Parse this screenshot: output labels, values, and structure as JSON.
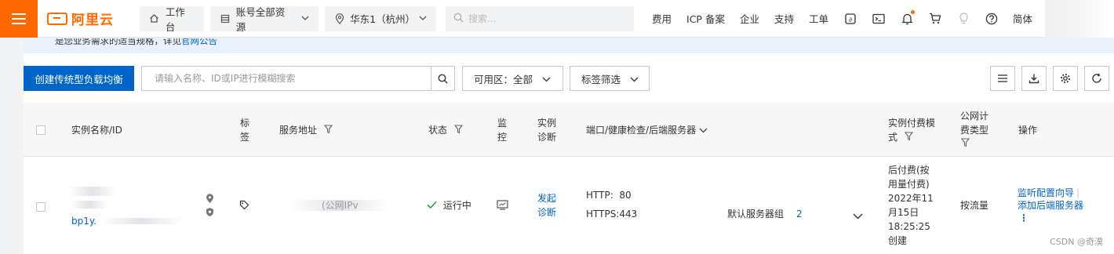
{
  "brand": {
    "name": "阿里云",
    "color": "#ff6a00"
  },
  "topbar": {
    "workbench": "工作台",
    "resources": "账号全部资源",
    "region": "华东1（杭州）",
    "search_placeholder": "搜索...",
    "links": [
      "费用",
      "ICP 备案",
      "企业",
      "支持",
      "工单"
    ],
    "icons": [
      "cloud-shell-icon",
      "terminal-icon",
      "bell-icon",
      "cart-icon",
      "bulb-icon",
      "help-icon"
    ],
    "lang": "简体"
  },
  "notice": {
    "text": "是您业务需求的适当规格，详见",
    "link": "官网公告"
  },
  "toolbar": {
    "create_label": "创建传统型负载均衡",
    "search_placeholder": "请输入名称、ID或IP进行模糊搜索",
    "zone_label": "可用区：",
    "zone_value": "全部",
    "tag_filter": "标签筛选"
  },
  "table": {
    "headers": {
      "name": "实例名称/ID",
      "tag_1": "标",
      "tag_2": "签",
      "address": "服务地址",
      "status": "状态",
      "monitor_1": "监",
      "monitor_2": "控",
      "diag_1": "实例",
      "diag_2": "诊断",
      "ports": "端口/健康检查/后端服务器",
      "billing_1": "实例付费模",
      "billing_2": "式",
      "net_1": "公网计",
      "net_2": "费类型",
      "actions": "操作"
    },
    "row": {
      "id_prefix": "bp1y.",
      "address_suffix": "(公网IPv",
      "status": "运行中",
      "diag_1": "发起",
      "diag_2": "诊断",
      "http": "HTTP:  80",
      "https": "HTTPS:443",
      "server_group": "默认服务器组",
      "server_count": "2",
      "billing": [
        "后付费(按",
        "用量付费)",
        "2022年11",
        "月15日",
        "18:25:25",
        "创建"
      ],
      "net_billing": "按流量",
      "action_1": "监听配置向导",
      "action_2": "添加后端服务器",
      "more": "⋮"
    }
  },
  "watermark": "CSDN @奇漠",
  "colors": {
    "primary": "#0064c8",
    "success": "#1aa33b",
    "notice_bg": "#e8f1fc"
  }
}
